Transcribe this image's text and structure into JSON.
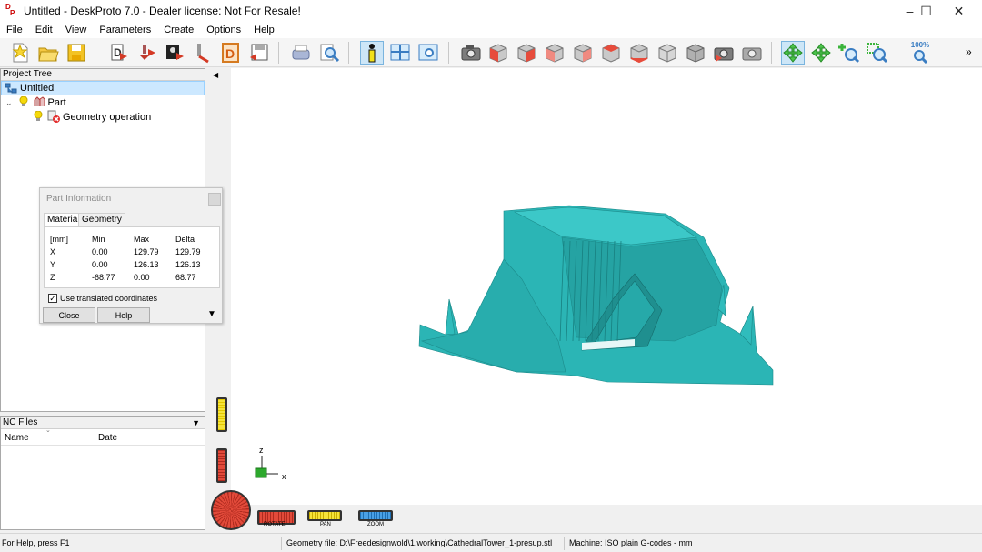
{
  "window": {
    "title": "Untitled - DeskProto 7.0 - Dealer license: Not For Resale!",
    "app_icon_letters": "DP",
    "minimize": "–",
    "maximize": "☐",
    "close": "✕"
  },
  "menu": [
    "File",
    "Edit",
    "View",
    "Parameters",
    "Create",
    "Options",
    "Help"
  ],
  "toolbar": {
    "zoom_100_label": "100%",
    "overflow": "»",
    "icons": [
      "new-file-icon",
      "open-folder-icon",
      "save-icon",
      "part-import-icon",
      "vector-import-icon",
      "bitmap-import-icon",
      "cutter-icon",
      "drawing-icon",
      "export-icon",
      "print-icon",
      "preview-icon",
      "info-icon",
      "grid-view-icon",
      "window-view-icon",
      "camera-icon",
      "view-cube-front-icon",
      "view-cube-right-icon",
      "view-cube-back-icon",
      "view-cube-left-icon",
      "view-cube-top-icon",
      "view-cube-bottom-icon",
      "view-cube-iso-icon",
      "view-cube-grey-icon",
      "render-icon",
      "render-grey-icon",
      "rotate-icon",
      "pan-icon",
      "zoom-in-icon",
      "zoom-window-icon",
      "zoom-100-icon"
    ]
  },
  "project_tree": {
    "header": "Project Tree",
    "root": "Untitled",
    "part": "Part",
    "operation": "Geometry operation"
  },
  "nc_files": {
    "header": "NC Files",
    "col_name": "Name",
    "col_date": "Date"
  },
  "part_info": {
    "title": "Part Information",
    "tabs": [
      "Material",
      "Geometry"
    ],
    "headers": [
      "[mm]",
      "Min",
      "Max",
      "Delta"
    ],
    "rows": [
      {
        "axis": "X",
        "min": "0.00",
        "max": "129.79",
        "delta": "129.79"
      },
      {
        "axis": "Y",
        "min": "0.00",
        "max": "126.13",
        "delta": "126.13"
      },
      {
        "axis": "Z",
        "min": "-68.77",
        "max": "0.00",
        "delta": "68.77"
      }
    ],
    "checkbox_label": "Use translated coordinates",
    "checkbox_checked": true,
    "close_label": "Close",
    "help_label": "Help"
  },
  "viewport": {
    "model_color": "#2bb5b5",
    "axis_z": "z",
    "axis_x": "x",
    "rotate_label": "ROTATE",
    "pan_label": "PAN",
    "zoom_label": "ZOOM"
  },
  "statusbar": {
    "help": "For Help, press F1",
    "geometry_file": "Geometry file: D:\\Freedesignwold\\1.working\\CathedralTower_1-presup.stl",
    "machine": "Machine: ISO plain G-codes - mm"
  }
}
